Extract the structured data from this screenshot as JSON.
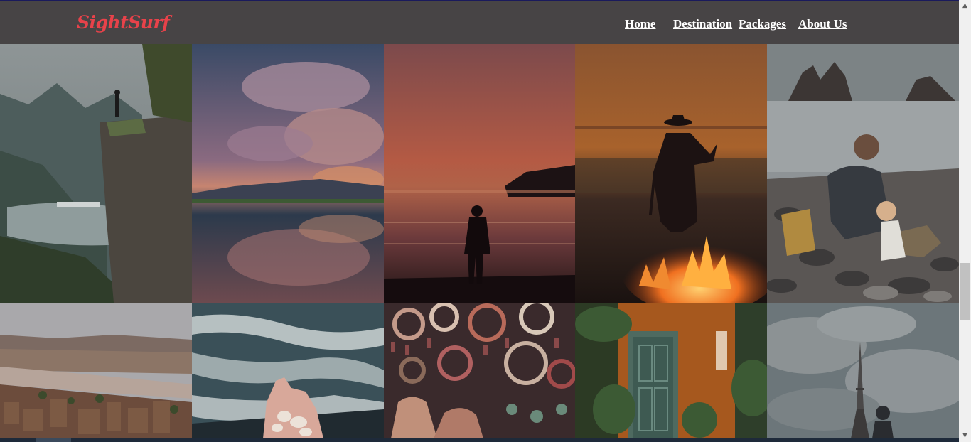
{
  "brand": {
    "logo_text": "SightSurf",
    "logo_color": "#e8424a"
  },
  "nav": {
    "items": [
      "Home",
      "Destination",
      "Packages",
      "About Us"
    ]
  },
  "gallery": {
    "photos": [
      "fjord-cliff-hiker",
      "cloud-reflection-lake",
      "sunset-beach-silhouette",
      "campfire-dancer",
      "father-child-rocky-beach",
      "desert-kasbah-village",
      "ocean-wave-seashells",
      "bazaar-textile-decor",
      "orange-wall-green-door",
      "eiffel-tower-cloudy-sky"
    ]
  },
  "scrollbar": {
    "up_icon": "▲",
    "down_icon": "▼"
  }
}
